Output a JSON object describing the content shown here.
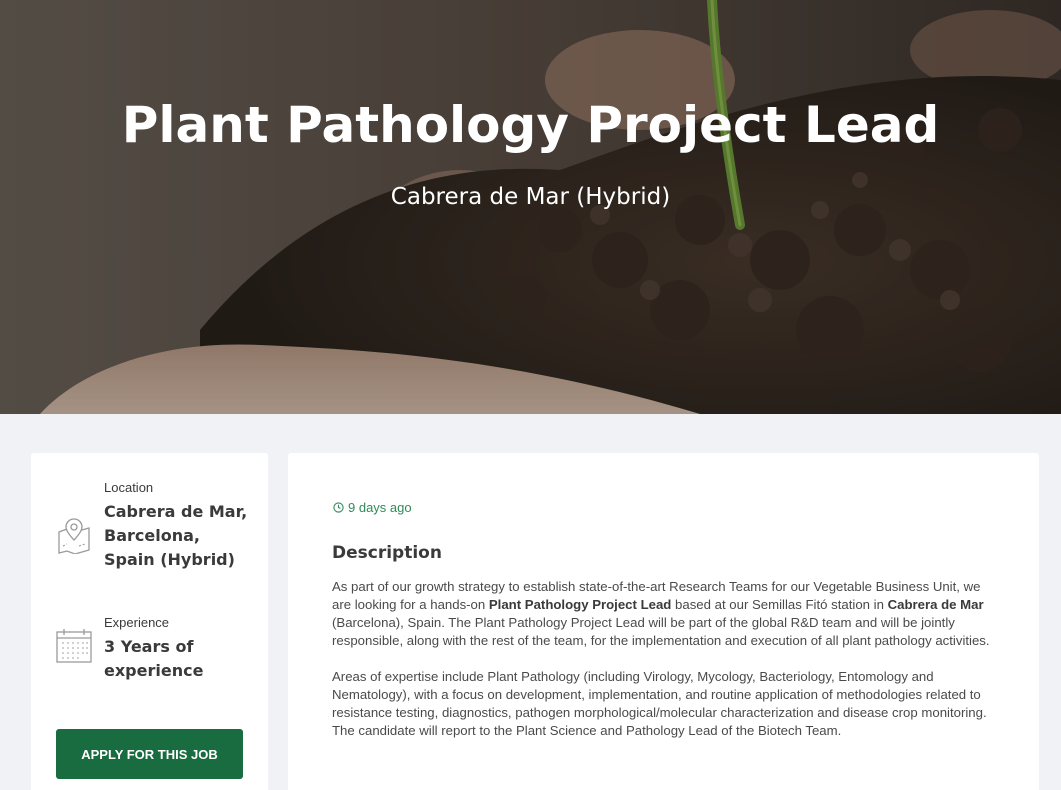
{
  "hero": {
    "title": "Plant Pathology Project Lead",
    "subtitle": "Cabrera de Mar (Hybrid)"
  },
  "sidebar": {
    "location": {
      "label": "Location",
      "value": "Cabrera de Mar, Barcelona, Spain (Hybrid)",
      "icon": "map-pin-icon"
    },
    "experience": {
      "label": "Experience",
      "value": "3 Years of experience",
      "icon": "calendar-icon"
    },
    "apply_label": "APPLY FOR THIS JOB"
  },
  "main": {
    "posted": "9 days ago",
    "description_heading": "Description",
    "paragraph1": {
      "part1": "As part of our growth strategy to establish state-of-the-art Research Teams for our Vegetable Business Unit, we are looking for a hands-on ",
      "bold1": "Plant Pathology Project Lead",
      "part2": " based at our Semillas Fitó station in ",
      "bold2": "Cabrera de Mar",
      "part3": " (Barcelona), Spain. The Plant Pathology Project Lead will be part of the global R&D team and will be jointly responsible, along with the rest of the team, for the implementation and execution of all plant pathology activities."
    },
    "paragraph2": "Areas of expertise include Plant Pathology (including Virology, Mycology, Bacteriology, Entomology and Nematology), with a focus on development, implementation, and routine application of methodologies related to resistance testing, diagnostics, pathogen morphological/molecular characterization and disease crop monitoring. The candidate will report to the Plant Science and Pathology Lead of the Biotech Team."
  },
  "colors": {
    "accent": "#186c3f",
    "posted_text": "#2e8b57",
    "page_bg": "#f1f2f6"
  }
}
